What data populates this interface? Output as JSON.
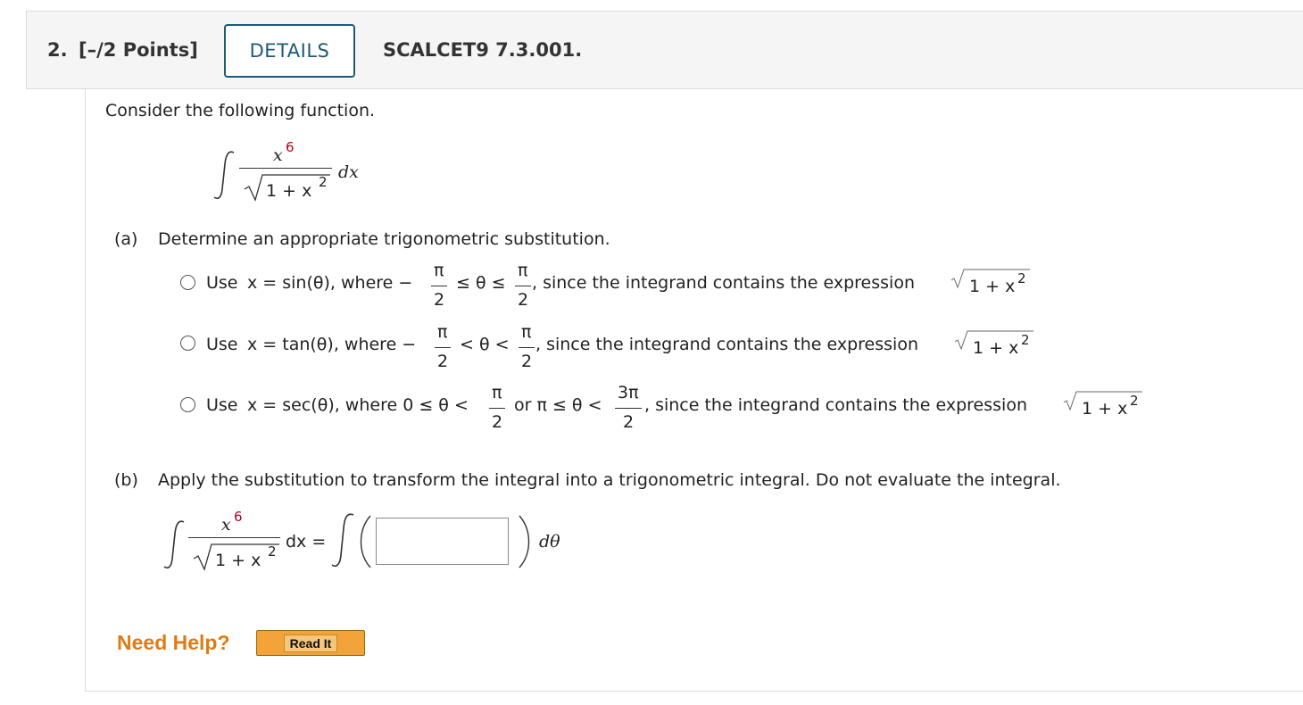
{
  "header": {
    "number": "2.",
    "points": "[–/2 Points]",
    "details_label": "DETAILS",
    "problem_id": "SCALCET9 7.3.001."
  },
  "intro": "Consider the following function.",
  "integral": {
    "numerator_base": "x",
    "numerator_exp": "6",
    "denominator": "1 + x",
    "denominator_exp": "2",
    "dx": "dx"
  },
  "part_a": {
    "label": "(a)",
    "prompt": "Determine an appropriate trigonometric substitution.",
    "options": [
      {
        "lead": "Use",
        "sub": "x = sin(θ), where −",
        "cond_mid": "≤ θ ≤",
        "tail": ", since the integrand contains the expression",
        "frac1_top": "π",
        "frac1_bot": "2",
        "frac2_top": "π",
        "frac2_bot": "2",
        "expr": "1 + x",
        "expr_exp": "2"
      },
      {
        "lead": "Use",
        "sub": "x = tan(θ), where −",
        "cond_mid": "< θ <",
        "tail": ", since the integrand contains the expression",
        "frac1_top": "π",
        "frac1_bot": "2",
        "frac2_top": "π",
        "frac2_bot": "2",
        "expr": "1 + x",
        "expr_exp": "2"
      },
      {
        "lead": "Use",
        "sub": "x = sec(θ), where 0 ≤ θ <",
        "cond_mid": "or π ≤ θ <",
        "tail": ", since the integrand contains the expression",
        "frac1_top": "π",
        "frac1_bot": "2",
        "frac2_top": "3π",
        "frac2_bot": "2",
        "expr": "1 + x",
        "expr_exp": "2"
      }
    ]
  },
  "part_b": {
    "label": "(b)",
    "prompt": "Apply the substitution to transform the integral into a trigonometric integral. Do not evaluate the integral.",
    "equals": "dx =",
    "dtheta": "dθ",
    "answer_value": ""
  },
  "help": {
    "label": "Need Help?",
    "read_it": "Read It"
  }
}
